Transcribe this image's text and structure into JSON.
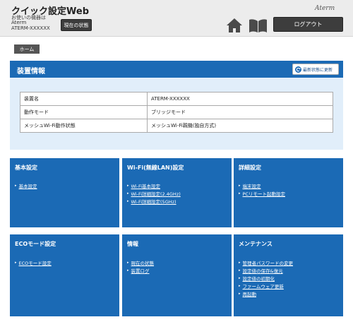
{
  "header": {
    "app_title": "クイック設定Web",
    "device_caption": "お使いの機器は",
    "device_brand": "Aterm",
    "device_model": "ATERM-XXXXXX",
    "status_button": "現在の状態",
    "logo_text": "Aterm",
    "logout_button": "ログアウト"
  },
  "breadcrumb": {
    "home": "ホーム"
  },
  "device_panel": {
    "title": "装置情報",
    "refresh_button": "最新状態に更新",
    "rows": [
      {
        "key": "装置名",
        "value": "ATERM-XXXXXX"
      },
      {
        "key": "動作モード",
        "value": "ブリッジモード"
      },
      {
        "key": "メッシュWi-Fi動作状態",
        "value": "メッシュWi-Fi親機(独自方式)"
      }
    ]
  },
  "menu_cards": [
    {
      "title": "基本設定",
      "links": [
        "基本設定"
      ]
    },
    {
      "title": "Wi-Fi(無線LAN)設定",
      "links": [
        "Wi-Fi基本設定",
        "Wi-Fi詳細設定(2.4GHz)",
        "Wi-Fi詳細設定(5GHz)"
      ]
    },
    {
      "title": "詳細設定",
      "links": [
        "端末設定",
        "PCリモート起動設定"
      ]
    },
    {
      "title": "ECOモード設定",
      "links": [
        "ECOモード設定"
      ]
    },
    {
      "title": "情報",
      "links": [
        "現在の状態",
        "装置ログ"
      ]
    },
    {
      "title": "メンテナンス",
      "links": [
        "管理者パスワードの変更",
        "設定値の保存&復元",
        "設定値の初期化",
        "ファームウェア更新",
        "再起動"
      ]
    }
  ],
  "colors": {
    "accent": "#1b6ab5",
    "panel_bg": "#e1eefa",
    "header_bg": "#ececec",
    "dark_button": "#3d3d3d"
  }
}
